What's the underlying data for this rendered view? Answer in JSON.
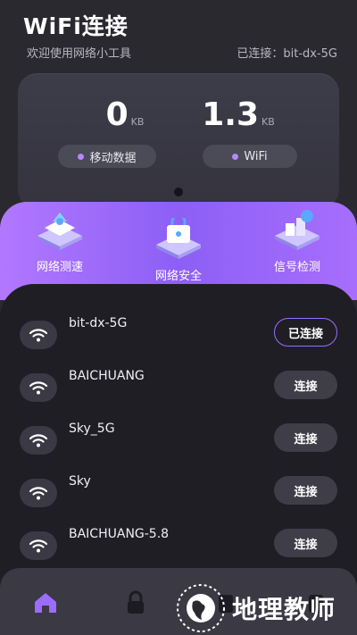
{
  "app": {
    "title": "WiFi连接",
    "welcome": "欢迎使用网络小工具",
    "connection_status": "已连接：bit-dx-5G"
  },
  "stats": {
    "mobile": {
      "value": "0",
      "unit": "KB",
      "label": "移动数据"
    },
    "wifi": {
      "value": "1.3",
      "unit": "KB",
      "label": "WiFi"
    }
  },
  "tools": [
    {
      "label": "网络测速",
      "icon": "speed-test-icon"
    },
    {
      "label": "网络安全",
      "icon": "security-icon"
    },
    {
      "label": "信号检测",
      "icon": "signal-detect-icon"
    }
  ],
  "networks": [
    {
      "name": "bit-dx-5G",
      "action": "已连接",
      "connected": true
    },
    {
      "name": "BAICHUANG",
      "action": "连接",
      "connected": false
    },
    {
      "name": "Sky_5G",
      "action": "连接",
      "connected": false
    },
    {
      "name": "Sky",
      "action": "连接",
      "connected": false
    },
    {
      "name": "BAICHUANG-5.8",
      "action": "连接",
      "connected": false
    }
  ],
  "tabbar": {
    "tabs": [
      "home-icon",
      "lock-icon",
      "tab-3-icon",
      "tab-4-icon"
    ],
    "active": 0
  },
  "watermark": {
    "text": "地理教师"
  },
  "colors": {
    "accent": "#9b6cff",
    "background": "#2a2930",
    "panel": "#1f1e25",
    "band": "#a270fb"
  }
}
